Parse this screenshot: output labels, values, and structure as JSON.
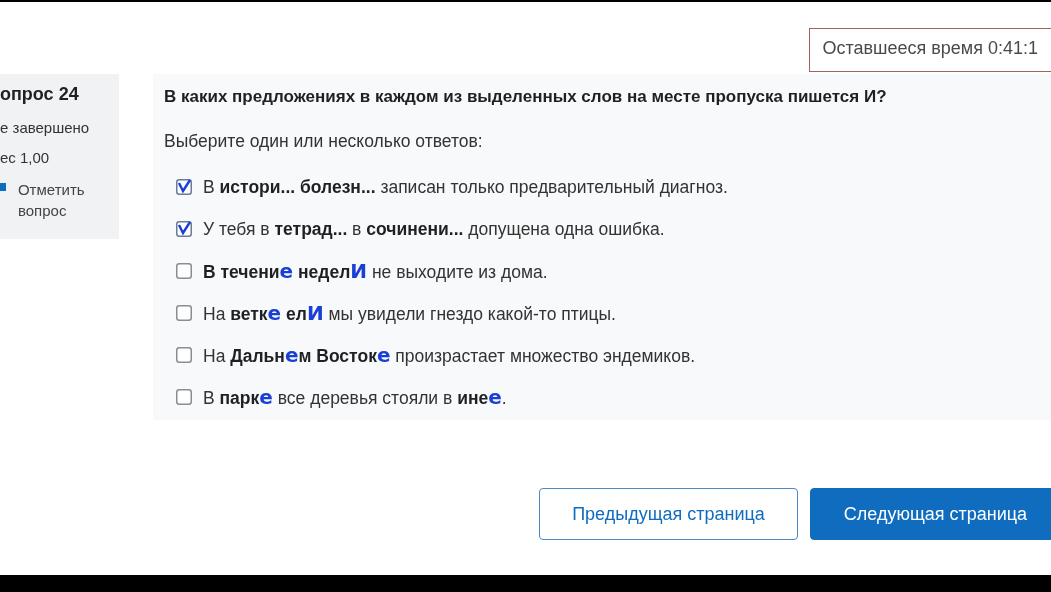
{
  "timer": {
    "text": "Оставшееся время 0:41:1"
  },
  "sidebar": {
    "question_number": "опрос 24",
    "status": "е завершено",
    "grade": "ес 1,00",
    "flag_label": "Отметить вопрос"
  },
  "question": {
    "prompt": "В каких предложениях в каждом из выделенных слов на месте пропуска пишется И?",
    "instruction": "Выберите один или несколько ответов:",
    "options": [
      {
        "checked": true,
        "segments": [
          {
            "kind": "plain",
            "text": "В "
          },
          {
            "kind": "bold",
            "text": "истори... болезн..."
          },
          {
            "kind": "plain",
            "text": " записан только предварительный диагноз."
          }
        ]
      },
      {
        "checked": true,
        "segments": [
          {
            "kind": "plain",
            "text": "У тебя в "
          },
          {
            "kind": "bold",
            "text": "тетрад..."
          },
          {
            "kind": "plain",
            "text": " в "
          },
          {
            "kind": "bold",
            "text": "сочинени..."
          },
          {
            "kind": "plain",
            "text": " допущена одна ошибка."
          }
        ]
      },
      {
        "checked": false,
        "segments": [
          {
            "kind": "bold",
            "text": "В течени"
          },
          {
            "kind": "insert",
            "text": "е"
          },
          {
            "kind": "bold",
            "text": " недел"
          },
          {
            "kind": "insert",
            "text": "И"
          },
          {
            "kind": "plain",
            "text": " не выходите из дома."
          }
        ]
      },
      {
        "checked": false,
        "segments": [
          {
            "kind": "plain",
            "text": "На "
          },
          {
            "kind": "bold",
            "text": "ветк"
          },
          {
            "kind": "insert",
            "text": "е"
          },
          {
            "kind": "bold",
            "text": " ел"
          },
          {
            "kind": "insert",
            "text": "И"
          },
          {
            "kind": "plain",
            "text": " мы увидели гнездо какой-то птицы."
          }
        ]
      },
      {
        "checked": false,
        "segments": [
          {
            "kind": "plain",
            "text": "На "
          },
          {
            "kind": "bold",
            "text": "Дальн"
          },
          {
            "kind": "insert",
            "text": "е"
          },
          {
            "kind": "bold",
            "text": "м Восток"
          },
          {
            "kind": "insert",
            "text": "е"
          },
          {
            "kind": "plain",
            "text": " произрастает множество эндемиков."
          }
        ]
      },
      {
        "checked": false,
        "segments": [
          {
            "kind": "plain",
            "text": "В "
          },
          {
            "kind": "bold",
            "text": "парк"
          },
          {
            "kind": "insert",
            "text": "е"
          },
          {
            "kind": "plain",
            "text": " все деревья стояли в "
          },
          {
            "kind": "bold",
            "text": "ине"
          },
          {
            "kind": "insert",
            "text": "е"
          },
          {
            "kind": "plain",
            "text": "."
          }
        ]
      }
    ]
  },
  "buttons": [
    {
      "kind": "secondary",
      "label": "Предыдущая страница"
    },
    {
      "kind": "primary",
      "label": "Следующая страница"
    }
  ]
}
